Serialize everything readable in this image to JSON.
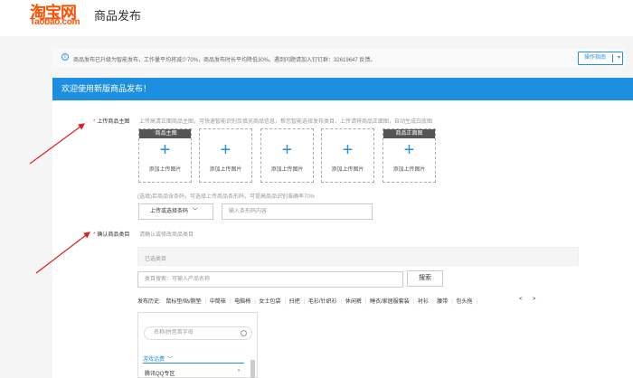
{
  "header": {
    "logo_cn": "淘宝网",
    "logo_en": "Taobao.com",
    "page_title": "商品发布"
  },
  "notice": {
    "text": "商品发布已升级为智能发布，工作量平均将减少70%，商品发布时长平均降低30%。遇到问题请加入钉钉群：32619647 反馈。",
    "guide_button": "操作指南"
  },
  "card": {
    "title": "欢迎使用新版商品发布！"
  },
  "upload_section": {
    "label": "上传商品主图",
    "hint": "上传高清正面商品主图，可快速智能识别及填充商品信息，帮您智能选择发布类目，上传请将商品正面图，自动生成白底图",
    "boxes": [
      {
        "tag": "商品主图",
        "tag_required": true,
        "label": "添加上传图片"
      },
      {
        "tag": "",
        "tag_required": false,
        "label": "添加上传图片"
      },
      {
        "tag": "",
        "tag_required": false,
        "label": "添加上传图片"
      },
      {
        "tag": "",
        "tag_required": false,
        "label": "添加上传图片"
      },
      {
        "tag": "商品正面图",
        "tag_required": false,
        "label": "添加上传图片"
      }
    ],
    "plus": "+",
    "barcode_hint": "(选填)若商品含条码，可选择上传商品条形码，可提高商品识别准确率70%",
    "barcode_button": "上传或选择条码",
    "barcode_placeholder": "输入条形码内容"
  },
  "category_section": {
    "label": "确认商品类目",
    "hint": "请确认或修改商品类目",
    "selected_placeholder": "已选类目",
    "search_placeholder": "类目搜索：可输入产品名称",
    "search_button": "搜索",
    "history_label": "发布历史:",
    "history_items": [
      "鼠标垫/贴/腕垫",
      "中筒袜",
      "电脑椅",
      "女士包袋",
      "扫把",
      "毛衫/针织衫",
      "休闲裤",
      "睡衣/家居服套装",
      "衬衫",
      "腰带",
      "包头拖"
    ],
    "history_trail": "|",
    "nav_prev": "<",
    "nav_next": ">",
    "tree_search_placeholder": "名称/拼音首字母",
    "tree_group": "游戏话费",
    "tree_item": "腾讯QQ专区"
  },
  "colors": {
    "brand_orange": "#ff5000",
    "header_blue": "#1d8fe0",
    "link_blue": "#2b8fd6",
    "required_red": "#ff3300",
    "annotation_red": "#e02020"
  },
  "icons": [
    "info-icon",
    "plus-icon",
    "chevron-down-icon",
    "search-icon",
    "chevron-right-icon"
  ]
}
